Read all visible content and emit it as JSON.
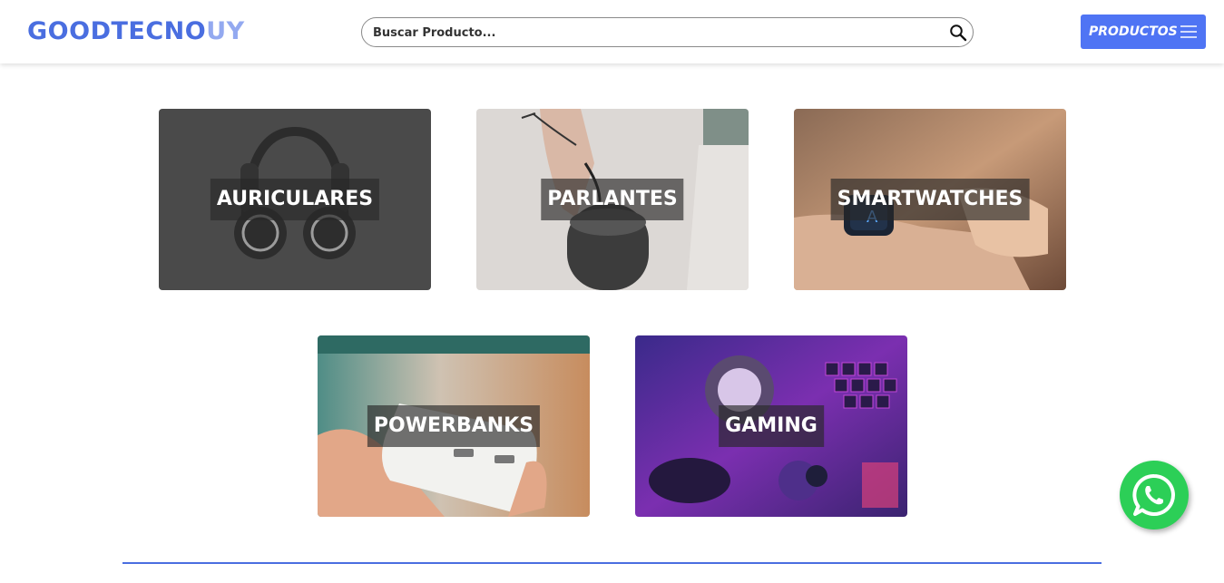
{
  "header": {
    "logo_part1": "GOODTECNO",
    "logo_part2": "UY",
    "search_placeholder": "Buscar Producto...",
    "products_label": "PRODUCTOS"
  },
  "categories": [
    {
      "label": "AURICULARES"
    },
    {
      "label": "PARLANTES"
    },
    {
      "label": "SMARTWATCHES"
    },
    {
      "label": "POWERBANKS"
    },
    {
      "label": "GAMING"
    }
  ],
  "icons": {
    "search": "search-icon",
    "menu": "hamburger-menu-icon",
    "whatsapp": "whatsapp-icon"
  },
  "colors": {
    "brand": "#4a6ee0",
    "brand_light": "#93a9f0",
    "button": "#4f74f4",
    "whatsapp": "#2ccf57"
  }
}
